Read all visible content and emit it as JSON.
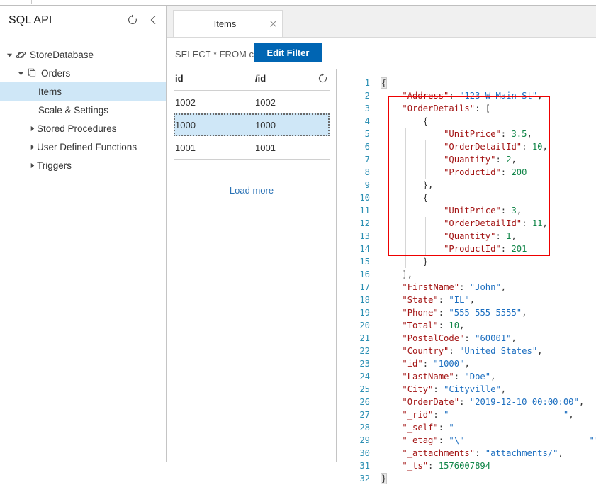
{
  "sidebar": {
    "title": "SQL API",
    "refresh_icon": "refresh-icon",
    "collapse_icon": "chevron-left-icon",
    "tree": [
      {
        "label": "StoreDatabase",
        "level": 0,
        "icon": "cosmos-database-icon",
        "expanded": true,
        "selected": false
      },
      {
        "label": "Orders",
        "level": 1,
        "icon": "container-documents-icon",
        "expanded": true,
        "selected": false
      },
      {
        "label": "Items",
        "level": 2,
        "icon": "",
        "expanded": null,
        "selected": true
      },
      {
        "label": "Scale & Settings",
        "level": 2,
        "icon": "",
        "expanded": null,
        "selected": false
      },
      {
        "label": "Stored Procedures",
        "level": 2,
        "icon": "",
        "expanded": false,
        "selected": false
      },
      {
        "label": "User Defined Functions",
        "level": 2,
        "icon": "",
        "expanded": false,
        "selected": false
      },
      {
        "label": "Triggers",
        "level": 2,
        "icon": "",
        "expanded": false,
        "selected": false
      }
    ]
  },
  "tab": {
    "label": "Items",
    "close_icon": "close-icon"
  },
  "query": {
    "text": "SELECT * FROM c",
    "edit_filter_label": "Edit Filter",
    "button_color": "#0065b3"
  },
  "itemlist": {
    "columns": [
      "id",
      "/id"
    ],
    "refresh_icon": "refresh-icon",
    "rows": [
      {
        "id": "1002",
        "pk": "1002",
        "selected": false
      },
      {
        "id": "1000",
        "pk": "1000",
        "selected": true
      },
      {
        "id": "1001",
        "pk": "1001",
        "selected": false
      }
    ],
    "load_more_label": "Load more",
    "selection_color": "#cfe7f7"
  },
  "editor": {
    "line_numbers": [
      1,
      2,
      3,
      4,
      5,
      6,
      7,
      8,
      9,
      10,
      11,
      12,
      13,
      14,
      15,
      16,
      17,
      18,
      19,
      20,
      21,
      22,
      23,
      24,
      25,
      26,
      27,
      28,
      29,
      30,
      31,
      32
    ],
    "highlight_color": "#ee0000",
    "lines": [
      {
        "n": 1,
        "indent": 0,
        "tokens": [
          {
            "t": "{",
            "c": "p",
            "brace": true
          }
        ]
      },
      {
        "n": 2,
        "indent": 1,
        "tokens": [
          {
            "t": "\"Address\"",
            "c": "k"
          },
          {
            "t": ": ",
            "c": "p"
          },
          {
            "t": "\"123 W Main St\"",
            "c": "s"
          },
          {
            "t": ",",
            "c": "p"
          }
        ]
      },
      {
        "n": 3,
        "indent": 1,
        "tokens": [
          {
            "t": "\"OrderDetails\"",
            "c": "k"
          },
          {
            "t": ": [",
            "c": "p"
          }
        ]
      },
      {
        "n": 4,
        "indent": 2,
        "tokens": [
          {
            "t": "{",
            "c": "p"
          }
        ]
      },
      {
        "n": 5,
        "indent": 3,
        "tokens": [
          {
            "t": "\"UnitPrice\"",
            "c": "k"
          },
          {
            "t": ": ",
            "c": "p"
          },
          {
            "t": "3.5",
            "c": "n"
          },
          {
            "t": ",",
            "c": "p"
          }
        ]
      },
      {
        "n": 6,
        "indent": 3,
        "tokens": [
          {
            "t": "\"OrderDetailId\"",
            "c": "k"
          },
          {
            "t": ": ",
            "c": "p"
          },
          {
            "t": "10",
            "c": "n"
          },
          {
            "t": ",",
            "c": "p"
          }
        ]
      },
      {
        "n": 7,
        "indent": 3,
        "tokens": [
          {
            "t": "\"Quantity\"",
            "c": "k"
          },
          {
            "t": ": ",
            "c": "p"
          },
          {
            "t": "2",
            "c": "n"
          },
          {
            "t": ",",
            "c": "p"
          }
        ]
      },
      {
        "n": 8,
        "indent": 3,
        "tokens": [
          {
            "t": "\"ProductId\"",
            "c": "k"
          },
          {
            "t": ": ",
            "c": "p"
          },
          {
            "t": "200",
            "c": "n"
          }
        ]
      },
      {
        "n": 9,
        "indent": 2,
        "tokens": [
          {
            "t": "},",
            "c": "p"
          }
        ]
      },
      {
        "n": 10,
        "indent": 2,
        "tokens": [
          {
            "t": "{",
            "c": "p"
          }
        ]
      },
      {
        "n": 11,
        "indent": 3,
        "tokens": [
          {
            "t": "\"UnitPrice\"",
            "c": "k"
          },
          {
            "t": ": ",
            "c": "p"
          },
          {
            "t": "3",
            "c": "n"
          },
          {
            "t": ",",
            "c": "p"
          }
        ]
      },
      {
        "n": 12,
        "indent": 3,
        "tokens": [
          {
            "t": "\"OrderDetailId\"",
            "c": "k"
          },
          {
            "t": ": ",
            "c": "p"
          },
          {
            "t": "11",
            "c": "n"
          },
          {
            "t": ",",
            "c": "p"
          }
        ]
      },
      {
        "n": 13,
        "indent": 3,
        "tokens": [
          {
            "t": "\"Quantity\"",
            "c": "k"
          },
          {
            "t": ": ",
            "c": "p"
          },
          {
            "t": "1",
            "c": "n"
          },
          {
            "t": ",",
            "c": "p"
          }
        ]
      },
      {
        "n": 14,
        "indent": 3,
        "tokens": [
          {
            "t": "\"ProductId\"",
            "c": "k"
          },
          {
            "t": ": ",
            "c": "p"
          },
          {
            "t": "201",
            "c": "n"
          }
        ]
      },
      {
        "n": 15,
        "indent": 2,
        "tokens": [
          {
            "t": "}",
            "c": "p"
          }
        ]
      },
      {
        "n": 16,
        "indent": 1,
        "tokens": [
          {
            "t": "],",
            "c": "p"
          }
        ]
      },
      {
        "n": 17,
        "indent": 1,
        "tokens": [
          {
            "t": "\"FirstName\"",
            "c": "k"
          },
          {
            "t": ": ",
            "c": "p"
          },
          {
            "t": "\"John\"",
            "c": "s"
          },
          {
            "t": ",",
            "c": "p"
          }
        ]
      },
      {
        "n": 18,
        "indent": 1,
        "tokens": [
          {
            "t": "\"State\"",
            "c": "k"
          },
          {
            "t": ": ",
            "c": "p"
          },
          {
            "t": "\"IL\"",
            "c": "s"
          },
          {
            "t": ",",
            "c": "p"
          }
        ]
      },
      {
        "n": 19,
        "indent": 1,
        "tokens": [
          {
            "t": "\"Phone\"",
            "c": "k"
          },
          {
            "t": ": ",
            "c": "p"
          },
          {
            "t": "\"555-555-5555\"",
            "c": "s"
          },
          {
            "t": ",",
            "c": "p"
          }
        ]
      },
      {
        "n": 20,
        "indent": 1,
        "tokens": [
          {
            "t": "\"Total\"",
            "c": "k"
          },
          {
            "t": ": ",
            "c": "p"
          },
          {
            "t": "10",
            "c": "n"
          },
          {
            "t": ",",
            "c": "p"
          }
        ]
      },
      {
        "n": 21,
        "indent": 1,
        "tokens": [
          {
            "t": "\"PostalCode\"",
            "c": "k"
          },
          {
            "t": ": ",
            "c": "p"
          },
          {
            "t": "\"60001\"",
            "c": "s"
          },
          {
            "t": ",",
            "c": "p"
          }
        ]
      },
      {
        "n": 22,
        "indent": 1,
        "tokens": [
          {
            "t": "\"Country\"",
            "c": "k"
          },
          {
            "t": ": ",
            "c": "p"
          },
          {
            "t": "\"United States\"",
            "c": "s"
          },
          {
            "t": ",",
            "c": "p"
          }
        ]
      },
      {
        "n": 23,
        "indent": 1,
        "tokens": [
          {
            "t": "\"id\"",
            "c": "k"
          },
          {
            "t": ": ",
            "c": "p"
          },
          {
            "t": "\"1000\"",
            "c": "s"
          },
          {
            "t": ",",
            "c": "p"
          }
        ]
      },
      {
        "n": 24,
        "indent": 1,
        "tokens": [
          {
            "t": "\"LastName\"",
            "c": "k"
          },
          {
            "t": ": ",
            "c": "p"
          },
          {
            "t": "\"Doe\"",
            "c": "s"
          },
          {
            "t": ",",
            "c": "p"
          }
        ]
      },
      {
        "n": 25,
        "indent": 1,
        "tokens": [
          {
            "t": "\"City\"",
            "c": "k"
          },
          {
            "t": ": ",
            "c": "p"
          },
          {
            "t": "\"Cityville\"",
            "c": "s"
          },
          {
            "t": ",",
            "c": "p"
          }
        ]
      },
      {
        "n": 26,
        "indent": 1,
        "tokens": [
          {
            "t": "\"OrderDate\"",
            "c": "k"
          },
          {
            "t": ": ",
            "c": "p"
          },
          {
            "t": "\"2019-12-10 00:00:00\"",
            "c": "s"
          },
          {
            "t": ",",
            "c": "p"
          }
        ]
      },
      {
        "n": 27,
        "indent": 1,
        "tokens": [
          {
            "t": "\"_rid\"",
            "c": "k"
          },
          {
            "t": ": ",
            "c": "p"
          },
          {
            "t": "\"                      \"",
            "c": "s"
          },
          {
            "t": ",",
            "c": "p"
          }
        ]
      },
      {
        "n": 28,
        "indent": 1,
        "tokens": [
          {
            "t": "\"_self\"",
            "c": "k"
          },
          {
            "t": ": ",
            "c": "p"
          },
          {
            "t": "\"",
            "c": "s"
          }
        ]
      },
      {
        "n": 29,
        "indent": 1,
        "tokens": [
          {
            "t": "\"_etag\"",
            "c": "k"
          },
          {
            "t": ": ",
            "c": "p"
          },
          {
            "t": "\"\\\"                        \"\"",
            "c": "s"
          },
          {
            "t": ",",
            "c": "p"
          }
        ]
      },
      {
        "n": 30,
        "indent": 1,
        "tokens": [
          {
            "t": "\"_attachments\"",
            "c": "k"
          },
          {
            "t": ": ",
            "c": "p"
          },
          {
            "t": "\"attachments/\"",
            "c": "s"
          },
          {
            "t": ",",
            "c": "p"
          }
        ]
      },
      {
        "n": 31,
        "indent": 1,
        "tokens": [
          {
            "t": "\"_ts\"",
            "c": "k"
          },
          {
            "t": ": ",
            "c": "p"
          },
          {
            "t": "1576007894",
            "c": "n"
          }
        ]
      },
      {
        "n": 32,
        "indent": 0,
        "tokens": [
          {
            "t": "}",
            "c": "p",
            "brace": true
          }
        ]
      }
    ]
  }
}
